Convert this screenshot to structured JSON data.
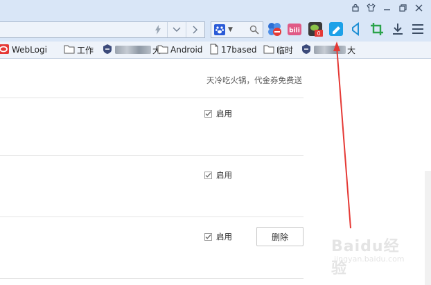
{
  "window": {
    "controls": [
      {
        "name": "lock-icon"
      },
      {
        "name": "skin-icon"
      },
      {
        "name": "minimize-icon"
      },
      {
        "name": "restore-icon"
      },
      {
        "name": "close-icon"
      }
    ]
  },
  "toolbar": {
    "url_buttons": [
      "lightning-icon",
      "chevron-down-icon",
      "chevron-right-icon"
    ],
    "search_engine_icon": "paw-icon",
    "search_icon": "search-icon",
    "extensions": [
      {
        "name": "account-ext-icon",
        "color": "#2d6fd4"
      },
      {
        "name": "bilibili-ext-icon",
        "label": "bili",
        "color": "#e05a86"
      },
      {
        "name": "wechat-ext-icon",
        "badge": "0",
        "color": "#3a3a3a"
      },
      {
        "name": "highlighted-ext-icon",
        "color": "#1da1e8"
      },
      {
        "name": "share-ext-icon",
        "color": "#1e8fd4"
      },
      {
        "name": "crop-ext-icon",
        "color": "#2aa34a"
      },
      {
        "name": "download-icon",
        "color": "#3b4c63"
      },
      {
        "name": "menu-icon",
        "color": "#3b4c63"
      }
    ]
  },
  "bookmarks": [
    {
      "label": "WebLogi",
      "icon": "oracle-icon"
    },
    {
      "label": "工作",
      "icon": "folder-icon"
    },
    {
      "label": "大",
      "icon": "site-icon",
      "blurred": true
    },
    {
      "label": "Android",
      "icon": "folder-icon"
    },
    {
      "label": "17based",
      "icon": "page-icon"
    },
    {
      "label": "临时",
      "icon": "folder-icon"
    },
    {
      "label": "大",
      "icon": "site-icon",
      "blurred": true
    }
  ],
  "content": {
    "promo_text": "天冷吃火锅，代金券免费送",
    "rows": [
      {
        "enabled_label": "启用",
        "checked": true
      },
      {
        "enabled_label": "启用",
        "checked": true
      },
      {
        "enabled_label": "启用",
        "checked": true,
        "delete_label": "删除"
      }
    ]
  },
  "annotation": {
    "color": "#e53935"
  },
  "watermark": {
    "main": "Baidu经验",
    "sub": "jingyan.baidu.com"
  }
}
